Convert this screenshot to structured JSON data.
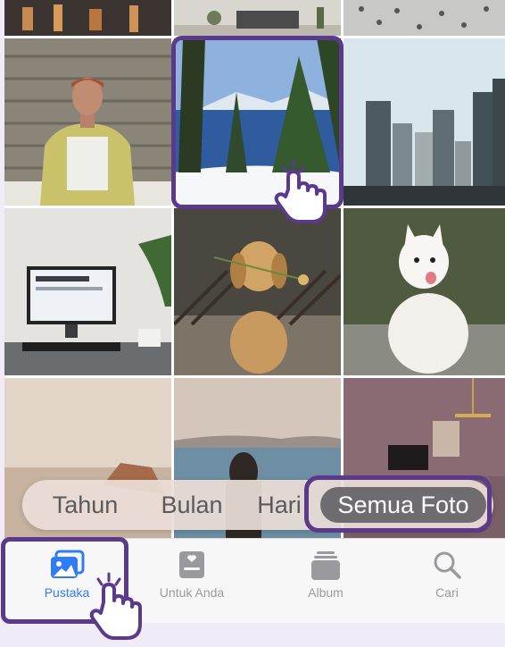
{
  "view_switcher": {
    "years": "Tahun",
    "months": "Bulan",
    "days": "Hari",
    "all_photos": "Semua Foto",
    "selected": "Semua Foto"
  },
  "tab_bar": {
    "items": [
      {
        "label": "Pustaka",
        "icon": "photo-library-icon",
        "active": true
      },
      {
        "label": "Untuk Anda",
        "icon": "for-you-icon",
        "active": false
      },
      {
        "label": "Album",
        "icon": "album-stack-icon",
        "active": false
      },
      {
        "label": "Cari",
        "icon": "search-icon",
        "active": false
      }
    ]
  },
  "colors": {
    "highlight": "#5b3a8c",
    "active_tab": "#2f7cf6",
    "inactive_tab": "#9a9a9e"
  }
}
